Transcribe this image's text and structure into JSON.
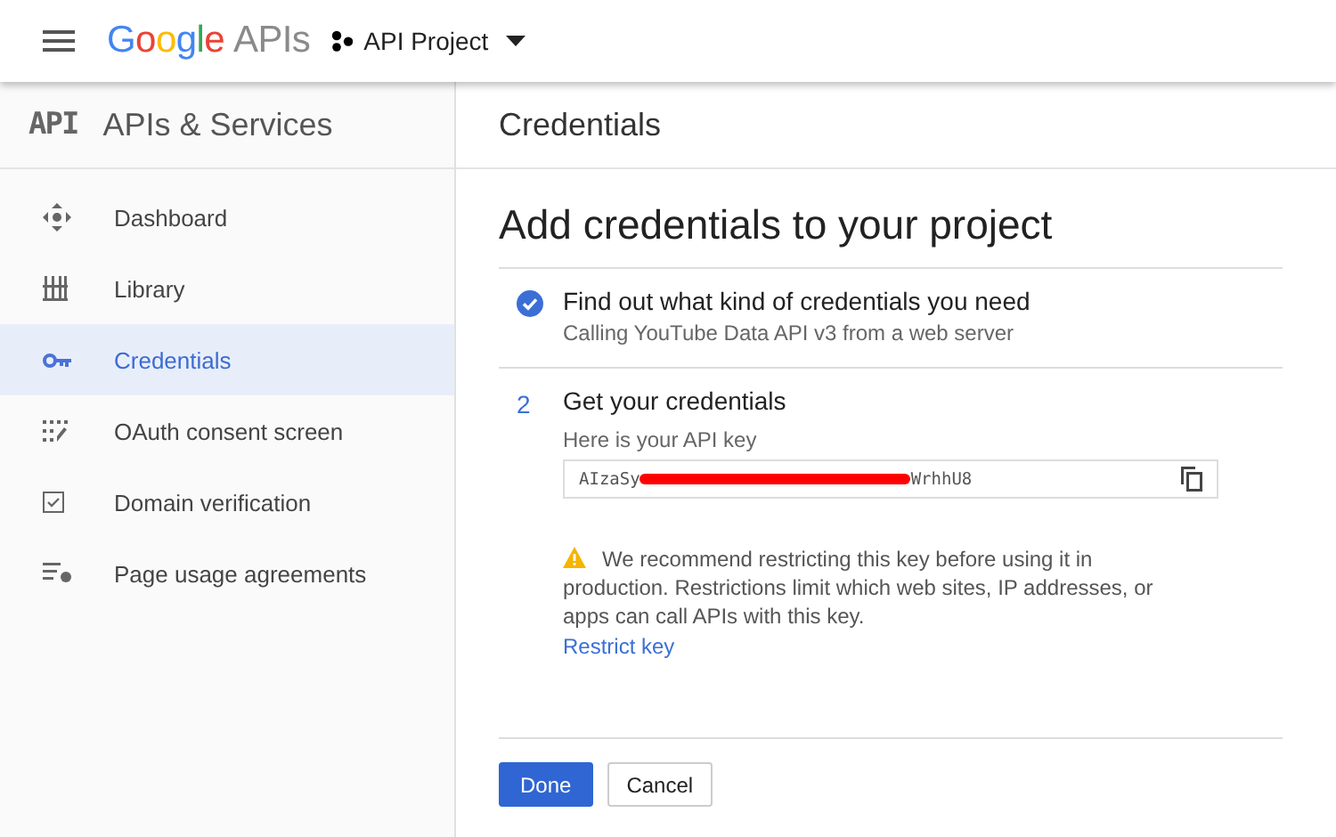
{
  "app_bar": {
    "logo": {
      "brand": "Google",
      "product": "APIs"
    },
    "project": "API Project"
  },
  "sidebar": {
    "badge": "API",
    "title": "APIs & Services",
    "items": [
      {
        "label": "Dashboard",
        "kind": "dashboard",
        "selected": false
      },
      {
        "label": "Library",
        "kind": "library",
        "selected": false
      },
      {
        "label": "Credentials",
        "kind": "key",
        "selected": true
      },
      {
        "label": "OAuth consent screen",
        "kind": "consent",
        "selected": false
      },
      {
        "label": "Domain verification",
        "kind": "domain",
        "selected": false
      },
      {
        "label": "Page usage agreements",
        "kind": "agreements",
        "selected": false
      }
    ]
  },
  "page_title": "Credentials",
  "heading": "Add credentials to your project",
  "steps": [
    {
      "kind": "done",
      "title": "Find out what kind of credentials you need",
      "subtitle": "Calling YouTube Data API v3 from a web server"
    },
    {
      "kind": "numbered",
      "number": "2",
      "title": "Get your credentials",
      "key_label": "Here is your API key",
      "key_start": "AIzaSy",
      "key_end": "WrhhU8",
      "warning": "We recommend restricting this key before using it in production. Restrictions limit which web sites, IP addresses, or apps can call APIs with this key.",
      "link": "Restrict key"
    }
  ],
  "buttons": [
    {
      "label": "Done",
      "primary": true
    },
    {
      "label": "Cancel",
      "primary": false
    }
  ]
}
